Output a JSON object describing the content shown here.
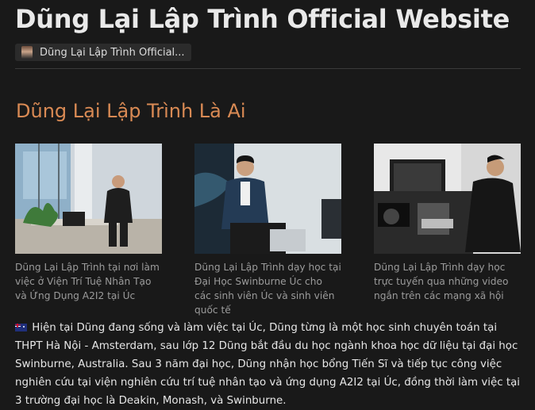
{
  "page": {
    "title": "Dũng Lại Lập Trình Official Website",
    "breadcrumb": "Dũng Lại Lập Trình Official..."
  },
  "section": {
    "heading": "Dũng Lại Lập Trình Là Ai"
  },
  "gallery": [
    {
      "caption": "Dũng Lại Lập Trình tại nơi làm việc ở Viện Trí Tuệ Nhân Tạo và Ứng Dụng A2I2 tại Úc"
    },
    {
      "caption": "Dũng Lại Lập Trình dạy học tại Đại Học Swinburne Úc cho các sinh viên Úc và sinh viên quốc tế"
    },
    {
      "caption": "Dũng Lại Lập Trình dạy học trực tuyến qua những video ngắn trên các mạng xã hội"
    }
  ],
  "bio": {
    "flag_icon": "australia-flag-icon",
    "text": "Hiện tại Dũng đang sống và làm việc tại Úc, Dũng từng là một học sinh chuyên toán tại THPT Hà Nội - Amsterdam, sau lớp 12 Dũng bắt đầu du học ngành khoa học dữ liệu tại đại học Swinburne, Australia.  Sau 3 năm đại học, Dũng nhận học bổng Tiến Sĩ và tiếp tục công việc nghiên cứu tại viện nghiên cứu trí tuệ nhân tạo và ứng dụng A2I2 tại Úc, đồng thời làm việc tại 3 trường đại học là Deakin, Monash, và Swinburne."
  }
}
